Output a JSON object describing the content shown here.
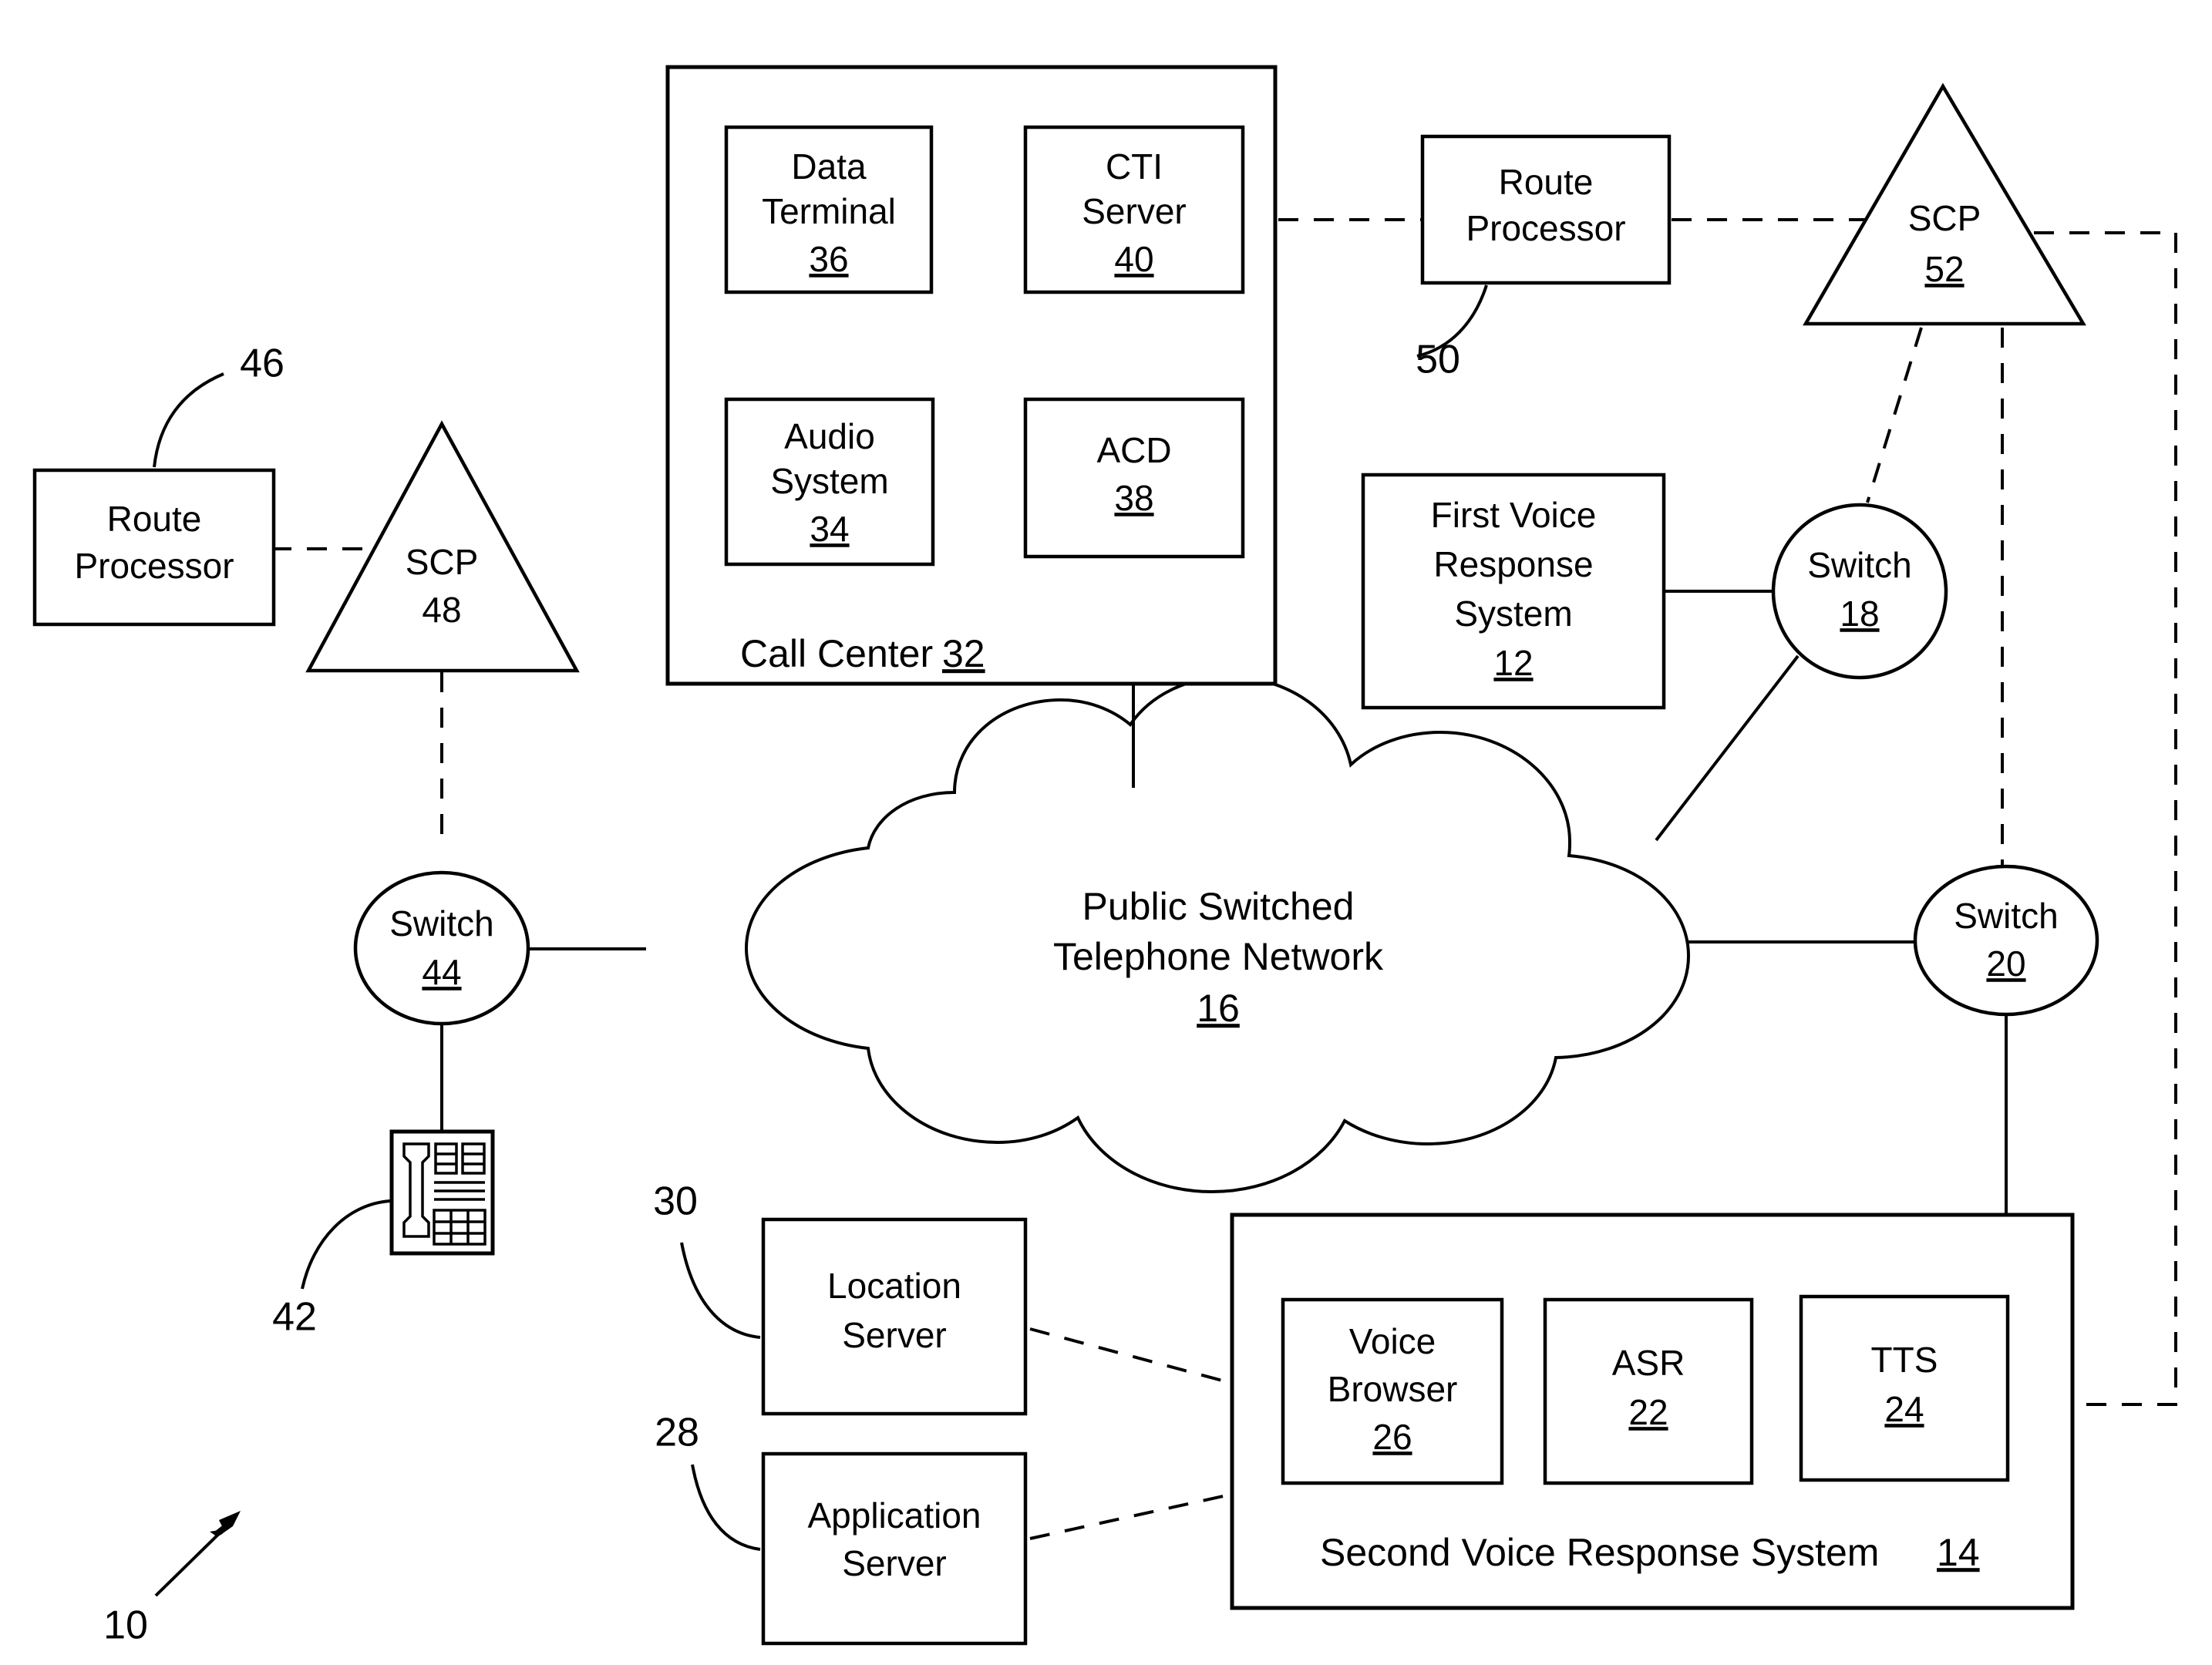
{
  "figure": {
    "kind": "patent-block-diagram",
    "overall_ref": "10",
    "background_color": "#ffffff",
    "line_color": "#000000"
  },
  "nodes": {
    "data_terminal": {
      "line1": "Data",
      "line2": "Terminal",
      "ref": "36"
    },
    "cti_server": {
      "line1": "CTI",
      "line2": "Server",
      "ref": "40"
    },
    "audio_system": {
      "line1": "Audio",
      "line2": "System",
      "ref": "34"
    },
    "acd": {
      "line1": "ACD",
      "ref": "38"
    },
    "call_center": {
      "label": "Call Center",
      "ref": "32"
    },
    "route_processor_50": {
      "line1": "Route",
      "line2": "Processor",
      "callout": "50"
    },
    "scp_52": {
      "label": "SCP",
      "ref": "52"
    },
    "first_voice_response_system": {
      "line1": "First Voice",
      "line2": "Response",
      "line3": "System",
      "ref": "12"
    },
    "switch_18": {
      "label": "Switch",
      "ref": "18"
    },
    "switch_20": {
      "label": "Switch",
      "ref": "20"
    },
    "route_processor_46": {
      "line1": "Route",
      "line2": "Processor",
      "callout": "46"
    },
    "scp_48": {
      "label": "SCP",
      "ref": "48"
    },
    "switch_44": {
      "label": "Switch",
      "ref": "44"
    },
    "telephone": {
      "callout": "42"
    },
    "pstn": {
      "line1": "Public Switched",
      "line2": "Telephone Network",
      "ref": "16"
    },
    "location_server": {
      "line1": "Location",
      "line2": "Server",
      "callout": "30"
    },
    "application_server": {
      "line1": "Application",
      "line2": "Server",
      "callout": "28"
    },
    "voice_browser": {
      "line1": "Voice",
      "line2": "Browser",
      "ref": "26"
    },
    "asr": {
      "label": "ASR",
      "ref": "22"
    },
    "tts": {
      "label": "TTS",
      "ref": "24"
    },
    "second_voice_response_system": {
      "label": "Second Voice Response System",
      "ref": "14"
    }
  }
}
